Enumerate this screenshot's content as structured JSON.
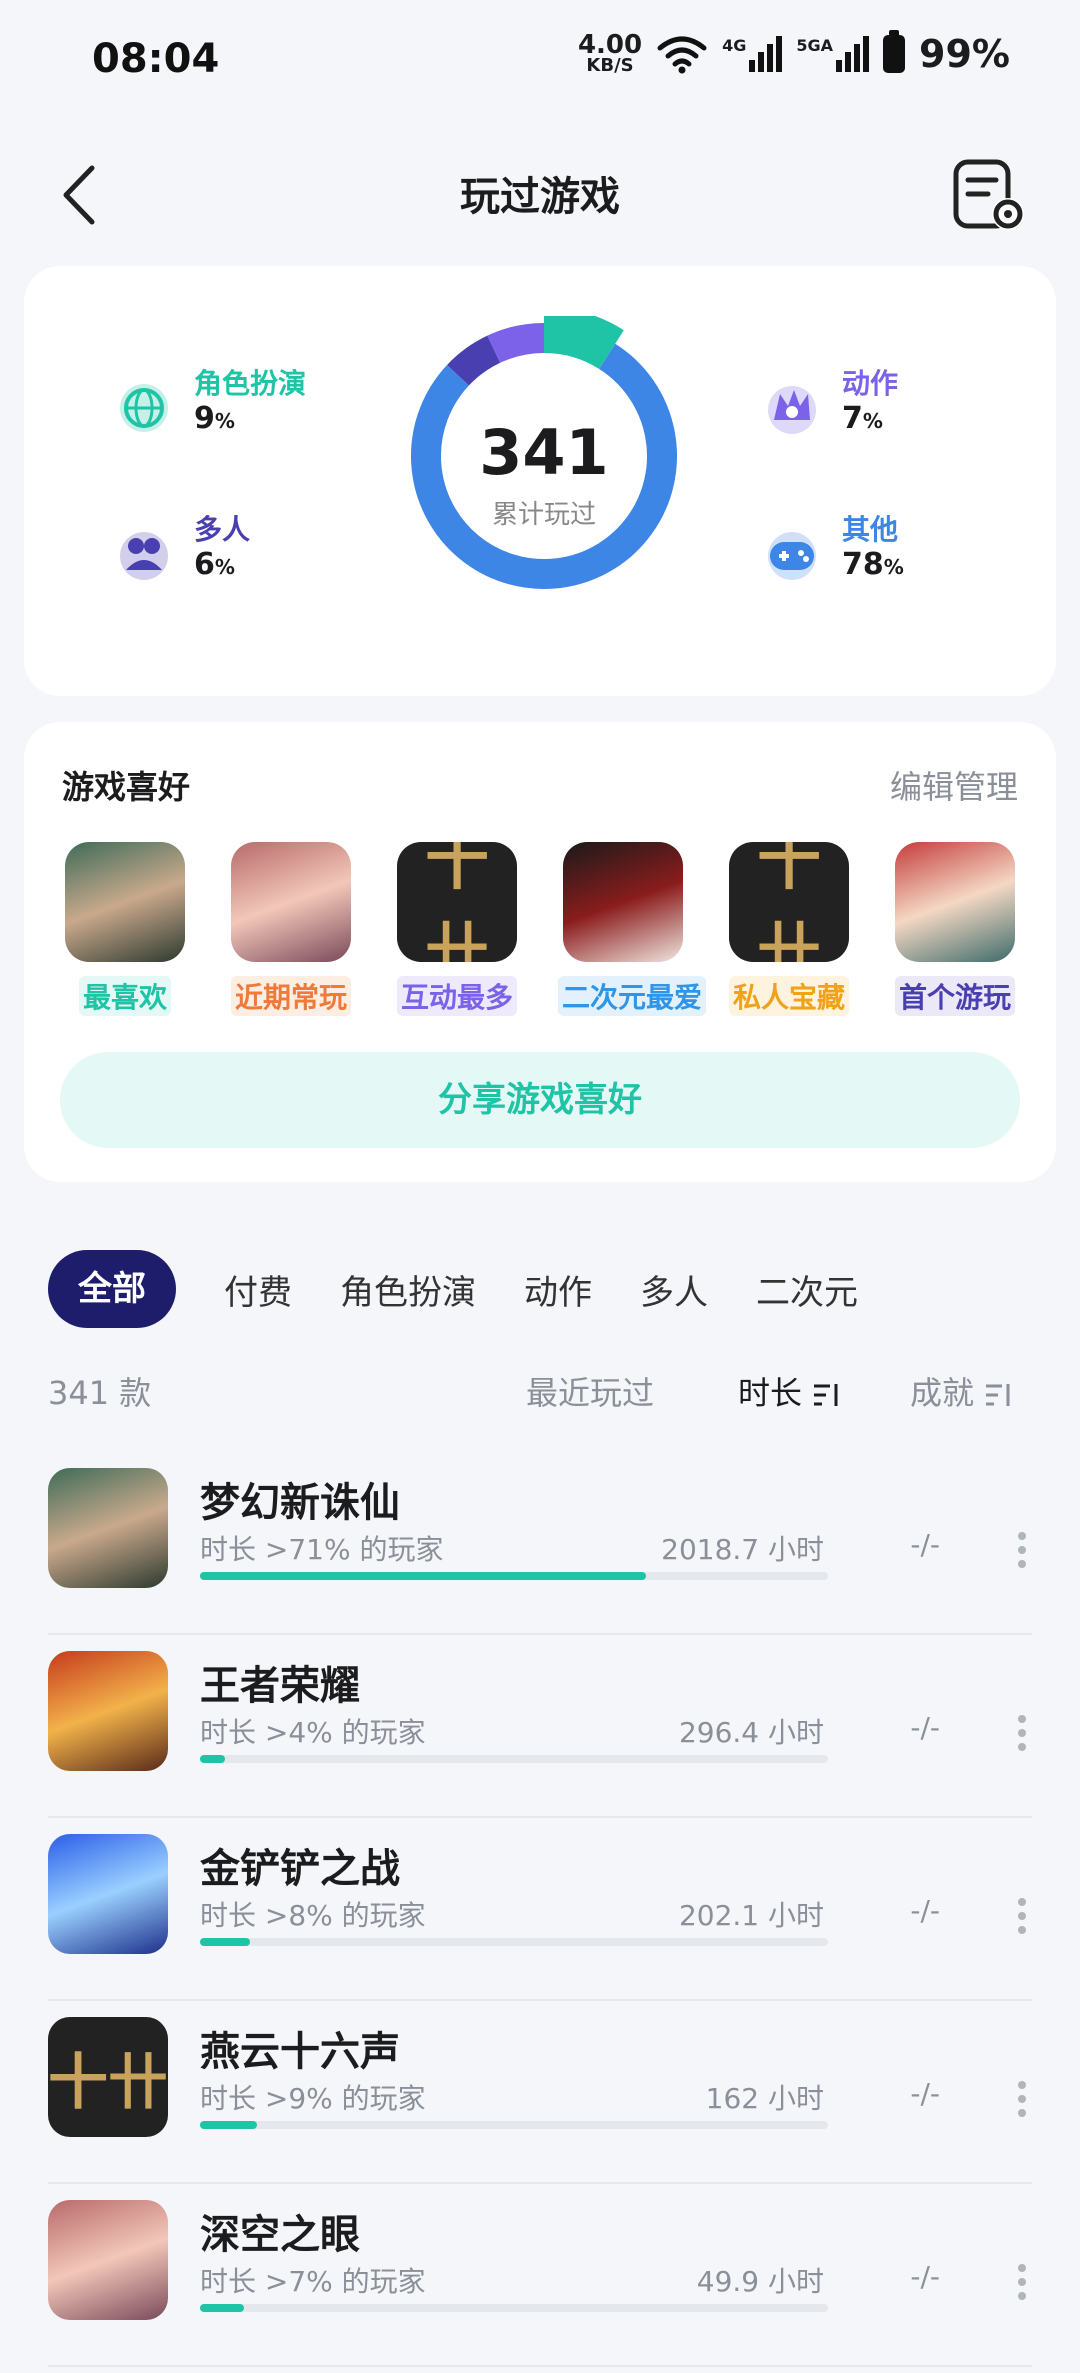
{
  "status": {
    "time": "08:04",
    "speed_value": "4.00",
    "speed_unit": "KB/S",
    "net1": "4G",
    "net2": "5GA",
    "battery": "99%"
  },
  "header": {
    "title": "玩过游戏"
  },
  "stats": {
    "total": "341",
    "total_label": "累计玩过",
    "categories": [
      {
        "name": "角色扮演",
        "pct": "9",
        "color": "#1ec4a5",
        "icon": "globe-icon"
      },
      {
        "name": "多人",
        "pct": "6",
        "color": "#4a3fb0",
        "icon": "multiplayer-icon"
      },
      {
        "name": "动作",
        "pct": "7",
        "color": "#7b62e8",
        "icon": "action-icon"
      },
      {
        "name": "其他",
        "pct": "78",
        "color": "#3d86e6",
        "icon": "gamepad-icon"
      }
    ],
    "pct_unit": "%"
  },
  "preference": {
    "title": "游戏喜好",
    "edit": "编辑管理",
    "items": [
      {
        "tag": "最喜欢",
        "tag_color": "#1ec4a5",
        "tag_bg": "#e4f8f5"
      },
      {
        "tag": "近期常玩",
        "tag_color": "#f07a3a",
        "tag_bg": "#fdeee4"
      },
      {
        "tag": "互动最多",
        "tag_color": "#7b62e8",
        "tag_bg": "#eeeafc"
      },
      {
        "tag": "二次元最爱",
        "tag_color": "#2e95e8",
        "tag_bg": "#e3f1fc"
      },
      {
        "tag": "私人宝藏",
        "tag_color": "#f0a21a",
        "tag_bg": "#fdf3de"
      },
      {
        "tag": "首个游玩",
        "tag_color": "#4a3fb0",
        "tag_bg": "#ebe9f7"
      }
    ],
    "share": "分享游戏喜好"
  },
  "tabs": [
    "全部",
    "付费",
    "角色扮演",
    "动作",
    "多人",
    "二次元"
  ],
  "list_header": {
    "count": "341 款",
    "sort_recent": "最近玩过",
    "sort_time": "时长",
    "sort_achieve": "成就"
  },
  "games": [
    {
      "name": "梦幻新诛仙",
      "sub": "时长 >71% 的玩家",
      "hours": "2018.7 小时",
      "progress": 0.71,
      "achievement": "-/-"
    },
    {
      "name": "王者荣耀",
      "sub": "时长 >4% 的玩家",
      "hours": "296.4 小时",
      "progress": 0.04,
      "achievement": "-/-"
    },
    {
      "name": "金铲铲之战",
      "sub": "时长 >8% 的玩家",
      "hours": "202.1 小时",
      "progress": 0.08,
      "achievement": "-/-"
    },
    {
      "name": "燕云十六声",
      "sub": "时长 >9% 的玩家",
      "hours": "162 小时",
      "progress": 0.09,
      "achievement": "-/-"
    },
    {
      "name": "深空之眼",
      "sub": "时长 >7% 的玩家",
      "hours": "49.9 小时",
      "progress": 0.07,
      "achievement": "-/-"
    }
  ]
}
